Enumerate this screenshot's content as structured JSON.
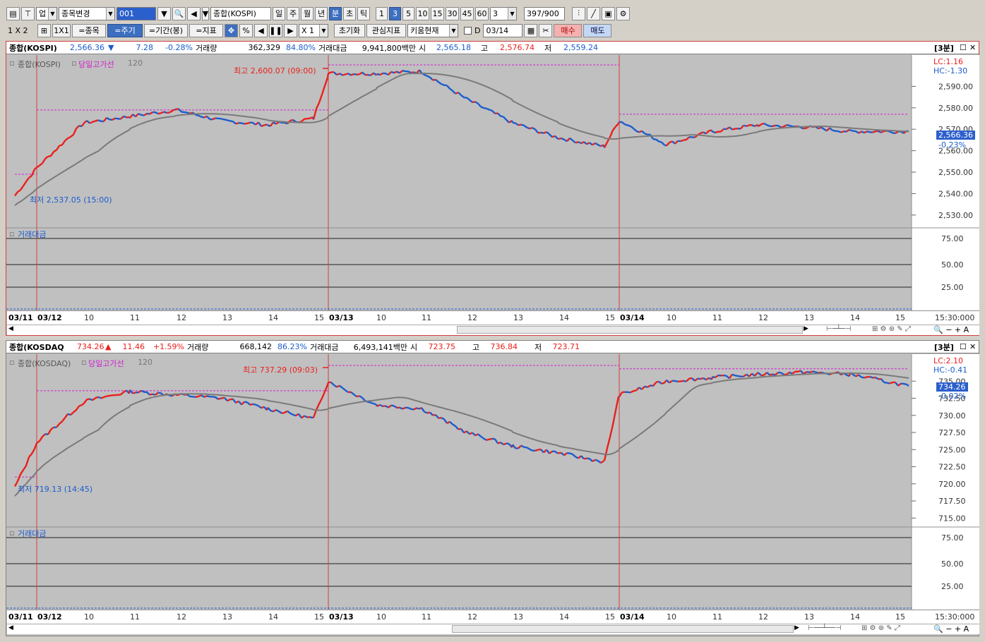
{
  "toolbar1": {
    "market_label": "업",
    "stock_change_label": "종목변경",
    "code_value": "001",
    "stock_name": "종합(KOSPI)",
    "period_buttons": [
      "일",
      "주",
      "월",
      "년",
      "분",
      "초",
      "틱"
    ],
    "period_selected": "분",
    "minute_buttons": [
      "1",
      "3",
      "5",
      "10",
      "15",
      "30",
      "45",
      "60"
    ],
    "minute_selected": "3",
    "minute_select_value": "3",
    "count_text": "397",
    "count_total": "/900"
  },
  "toolbar2": {
    "layout_label": "1 X 2",
    "one_by_one": "1X1",
    "item_btn": "=종목",
    "cycle_btn": "=주기",
    "period_btn": "=기간(봉)",
    "indicator_btn": "=지표",
    "percent": "%",
    "zoom_value": "X 1",
    "reset_btn": "초기화",
    "interest_btn": "관심지표",
    "kiwoom_btn": "키움현재",
    "d_label": "D",
    "date_value": "03/14",
    "buy_btn": "매수",
    "sell_btn": "매도"
  },
  "panel1": {
    "name": "종합(KOSPI)",
    "price": "2,566.36",
    "change": "7.28",
    "change_pct": "-0.28%",
    "volume_label": "거래량",
    "volume": "362,329",
    "volume_pct": "84.80%",
    "amount_label": "거래대금",
    "amount": "9,941,800백만",
    "open_label": "시",
    "open": "2,565.18",
    "high_label": "고",
    "high": "2,576.74",
    "low_label": "저",
    "low": "2,559.24",
    "interval": "[3분]",
    "legend_main": "종합(KOSPI)",
    "legend_highlow": "당일고가선",
    "legend_ma": "120",
    "lc": "LC:1.16",
    "hc": "HC:-1.30",
    "last_price_tag": "2,566.36",
    "last_pct_tag": "-0.23%",
    "max_annotation": "최고 2,600.07 (09:00)",
    "min_annotation": "최저 2,537.05 (15:00)",
    "sub_legend": "거래대금",
    "y_ticks": [
      "2,590.00",
      "2,580.00",
      "2,570.00",
      "2,560.00",
      "2,550.00",
      "2,540.00",
      "2,530.00"
    ],
    "sub_ticks": [
      "75.00",
      "50.00",
      "25.00"
    ],
    "x_labels": [
      "03/11",
      "03/12",
      "10",
      "11",
      "12",
      "13",
      "14",
      "15",
      "03/13",
      "10",
      "11",
      "12",
      "13",
      "14",
      "15",
      "03/14",
      "10",
      "11",
      "12",
      "13",
      "14",
      "15"
    ],
    "time_label": "15:30:000"
  },
  "panel2": {
    "name": "종합(KOSDAQ",
    "price": "734.26",
    "change": "11.46",
    "change_pct": "+1.59%",
    "volume_label": "거래량",
    "volume": "668,142",
    "volume_pct": "86.23%",
    "amount_label": "거래대금",
    "amount": "6,493,141백만",
    "open_label": "시",
    "open": "723.75",
    "high_label": "고",
    "high": "736.84",
    "low_label": "저",
    "low": "723.71",
    "interval": "[3분]",
    "legend_main": "종합(KOSDAQ)",
    "legend_highlow": "당일고가선",
    "legend_ma": "120",
    "lc": "LC:2.10",
    "hc": "HC:-0.41",
    "last_price_tag": "734.26",
    "last_pct_tag": "-0.02%",
    "max_annotation": "최고 737.29 (09:03)",
    "min_annotation": "최저 719.13 (14:45)",
    "sub_legend": "거래대금",
    "y_ticks": [
      "735.00",
      "732.50",
      "730.00",
      "727.50",
      "725.00",
      "722.50",
      "720.00",
      "717.50",
      "715.00"
    ],
    "sub_ticks": [
      "75.00",
      "50.00",
      "25.00"
    ],
    "x_labels": [
      "03/11",
      "03/12",
      "10",
      "11",
      "12",
      "13",
      "14",
      "15",
      "03/13",
      "10",
      "11",
      "12",
      "13",
      "14",
      "15",
      "03/14",
      "10",
      "11",
      "12",
      "13",
      "14",
      "15"
    ],
    "time_label": "15:30:000"
  },
  "colors": {
    "up": "#e8201c",
    "down": "#1a5ccc",
    "ma": "#7a7a7a",
    "highline": "#d020d0",
    "accent": "#3d6fc0"
  },
  "chart_data": [
    {
      "type": "line",
      "title": "종합(KOSPI)",
      "x": [
        "03/11 15:00",
        "03/12 09:00",
        "03/12 10:00",
        "03/12 11:00",
        "03/12 12:00",
        "03/12 13:00",
        "03/12 14:00",
        "03/12 15:00",
        "03/13 09:00",
        "03/13 10:00",
        "03/13 11:00",
        "03/13 12:00",
        "03/13 13:00",
        "03/13 14:00",
        "03/13 15:00",
        "03/14 09:00",
        "03/14 10:00",
        "03/14 11:00",
        "03/14 12:00",
        "03/14 13:00",
        "03/14 14:00",
        "03/14 15:00"
      ],
      "series": [
        {
          "values": [
            2539,
            2552,
            2573,
            2576,
            2579,
            2574,
            2572,
            2575,
            2596,
            2596,
            2597,
            2584,
            2573,
            2566,
            2562,
            2574,
            2563,
            2569,
            2572,
            2571,
            2569,
            2569
          ]
        }
      ],
      "ylim": [
        2525,
        2600
      ]
    },
    {
      "type": "line",
      "title": "종합(KOSDAQ)",
      "x": [
        "03/11 15:00",
        "03/12 09:00",
        "03/12 10:00",
        "03/12 11:00",
        "03/12 12:00",
        "03/12 13:00",
        "03/12 14:00",
        "03/12 15:00",
        "03/13 09:00",
        "03/13 10:00",
        "03/13 11:00",
        "03/13 12:00",
        "03/13 13:00",
        "03/13 14:00",
        "03/13 15:00",
        "03/14 09:00",
        "03/14 10:00",
        "03/14 11:00",
        "03/14 12:00",
        "03/14 13:00",
        "03/14 14:00",
        "03/14 15:00"
      ],
      "series": [
        {
          "values": [
            719.5,
            726,
            732,
            733.5,
            733,
            732.5,
            731,
            729.5,
            735,
            731.5,
            731,
            727.5,
            725.5,
            724.5,
            723.2,
            733,
            735,
            735.5,
            736,
            736.3,
            736,
            734.3
          ]
        }
      ],
      "ylim": [
        714,
        737.5
      ]
    }
  ]
}
